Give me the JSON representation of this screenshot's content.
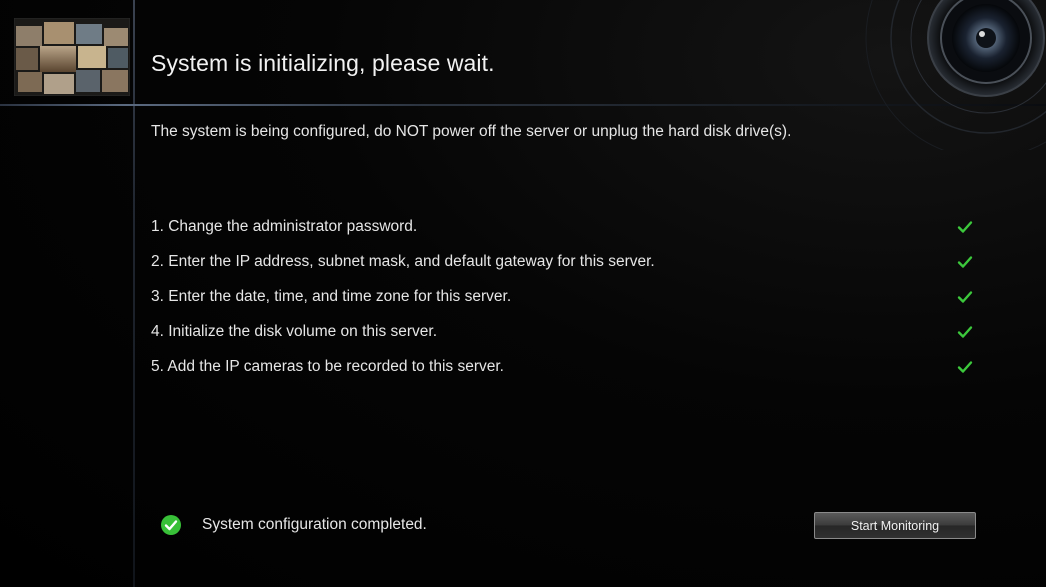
{
  "header": {
    "title": "System is initializing, please wait."
  },
  "warning": "The system is being configured, do NOT power off the server or unplug the hard disk drive(s).",
  "steps": [
    {
      "label": "1. Change the administrator password.",
      "done": true
    },
    {
      "label": "2. Enter the IP address, subnet mask, and default gateway for this server.",
      "done": true
    },
    {
      "label": "3. Enter the date, time, and time zone for this server.",
      "done": true
    },
    {
      "label": "4. Initialize the disk volume on this server.",
      "done": true
    },
    {
      "label": "5. Add the IP cameras to be recorded to this server.",
      "done": true
    }
  ],
  "status": {
    "text": "System configuration completed.",
    "icon": "check-circle-icon"
  },
  "actions": {
    "start_monitoring_label": "Start Monitoring"
  },
  "colors": {
    "background": "#000000",
    "check": "#3cc83c",
    "text": "#e6e6e6"
  }
}
